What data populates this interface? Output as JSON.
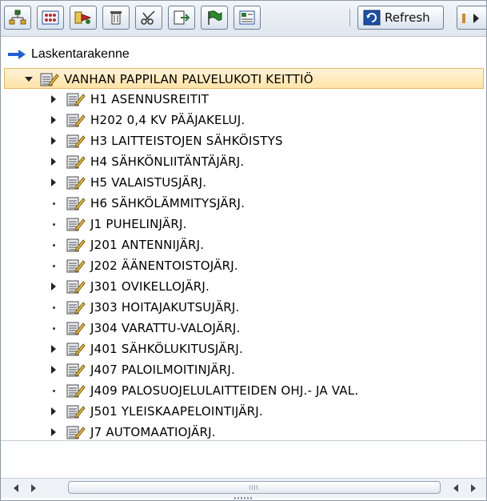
{
  "toolbar": {
    "buttons": [
      {
        "icon": "hierarchy-icon"
      },
      {
        "icon": "grid-select-icon"
      },
      {
        "icon": "transfer-icon"
      },
      {
        "icon": "trash-icon"
      },
      {
        "icon": "cut-icon"
      },
      {
        "icon": "insert-icon"
      },
      {
        "icon": "flag-icon"
      },
      {
        "icon": "properties-icon"
      }
    ],
    "refresh_label": "Refresh"
  },
  "header": {
    "title": "Laskentarakenne"
  },
  "tree": {
    "root": {
      "label": "VANHAN PAPPILAN PALVELUKOTI KEITTIÖ",
      "expanded": true
    },
    "items": [
      {
        "label": "H1 ASENNUSREITIT",
        "expandable": true
      },
      {
        "label": "H202 0,4 KV PÄÄJAKELUJ.",
        "expandable": true
      },
      {
        "label": "H3 LAITTEISTOJEN SÄHKÖISTYS",
        "expandable": true
      },
      {
        "label": "H4 SÄHKÖNLIITÄNTÄJÄRJ.",
        "expandable": true
      },
      {
        "label": "H5 VALAISTUSJÄRJ.",
        "expandable": true
      },
      {
        "label": "H6 SÄHKÖLÄMMITYSJÄRJ.",
        "expandable": false
      },
      {
        "label": "J1 PUHELINJÄRJ.",
        "expandable": false
      },
      {
        "label": "J201 ANTENNIJÄRJ.",
        "expandable": false
      },
      {
        "label": "J202 ÄÄNENTOISTOJÄRJ.",
        "expandable": false
      },
      {
        "label": "J301 OVIKELLOJÄRJ.",
        "expandable": true
      },
      {
        "label": "J303 HOITAJAKUTSUJÄRJ.",
        "expandable": false
      },
      {
        "label": "J304 VARATTU-VALOJÄRJ.",
        "expandable": false
      },
      {
        "label": "J401 SÄHKÖLUKITUSJÄRJ.",
        "expandable": true
      },
      {
        "label": "J407 PALOILMOITINJÄRJ.",
        "expandable": true
      },
      {
        "label": "J409 PALOSUOJELULAITTEIDEN OHJ.- JA VAL.",
        "expandable": false
      },
      {
        "label": "J501 YLEISKAAPELOINTIJÄRJ.",
        "expandable": true
      },
      {
        "label": "J7 AUTOMAATIOJÄRJ.",
        "expandable": true
      }
    ]
  },
  "colors": {
    "selected_row_bg": "#ffe3a8",
    "header_arrow": "#1f5fd6"
  }
}
